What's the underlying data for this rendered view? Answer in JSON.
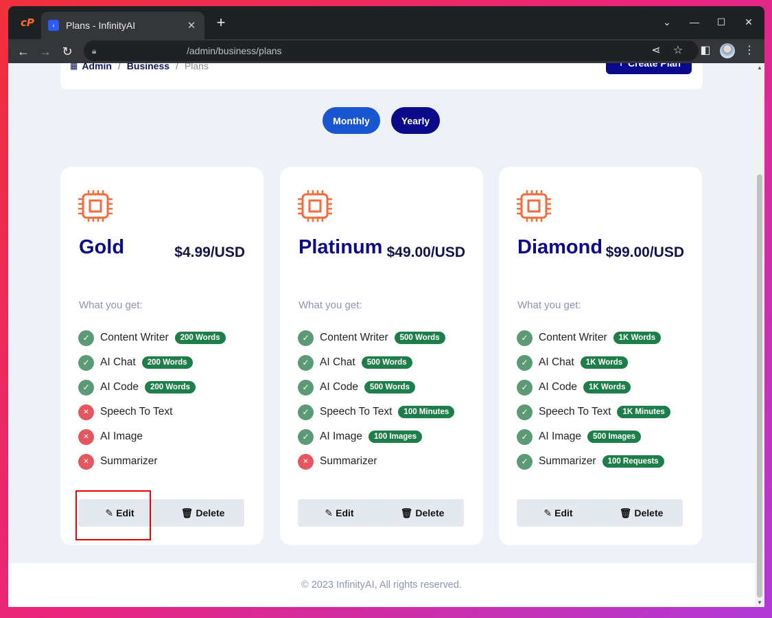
{
  "browser": {
    "tab_title": "Plans - InfinityAI",
    "url": "/admin/business/plans",
    "tab_close": "✕",
    "new_tab": "+"
  },
  "breadcrumb": {
    "items": [
      "Admin",
      "Business"
    ],
    "current": "Plans",
    "separator": "/"
  },
  "header": {
    "create_label": "Create Plan"
  },
  "billing_toggle": {
    "monthly": "Monthly",
    "yearly": "Yearly"
  },
  "plans": [
    {
      "name": "Gold",
      "price": "$4.99/USD",
      "what_you_get": "What you get:",
      "features": [
        {
          "label": "Content Writer",
          "included": true,
          "badge": "200 Words"
        },
        {
          "label": "AI Chat",
          "included": true,
          "badge": "200 Words"
        },
        {
          "label": "AI Code",
          "included": true,
          "badge": "200 Words"
        },
        {
          "label": "Speech To Text",
          "included": false,
          "badge": ""
        },
        {
          "label": "AI Image",
          "included": false,
          "badge": ""
        },
        {
          "label": "Summarizer",
          "included": false,
          "badge": ""
        }
      ],
      "edit_label": "Edit",
      "delete_label": "Delete"
    },
    {
      "name": "Platinum",
      "price": "$49.00/USD",
      "what_you_get": "What you get:",
      "features": [
        {
          "label": "Content Writer",
          "included": true,
          "badge": "500 Words"
        },
        {
          "label": "AI Chat",
          "included": true,
          "badge": "500 Words"
        },
        {
          "label": "AI Code",
          "included": true,
          "badge": "500 Words"
        },
        {
          "label": "Speech To Text",
          "included": true,
          "badge": "100 Minutes"
        },
        {
          "label": "AI Image",
          "included": true,
          "badge": "100 Images"
        },
        {
          "label": "Summarizer",
          "included": false,
          "badge": ""
        }
      ],
      "edit_label": "Edit",
      "delete_label": "Delete"
    },
    {
      "name": "Diamond",
      "price": "$99.00/USD",
      "what_you_get": "What you get:",
      "features": [
        {
          "label": "Content Writer",
          "included": true,
          "badge": "1K Words"
        },
        {
          "label": "AI Chat",
          "included": true,
          "badge": "1K Words"
        },
        {
          "label": "AI Code",
          "included": true,
          "badge": "1K Words"
        },
        {
          "label": "Speech To Text",
          "included": true,
          "badge": "1K Minutes"
        },
        {
          "label": "AI Image",
          "included": true,
          "badge": "500 Images"
        },
        {
          "label": "Summarizer",
          "included": true,
          "badge": "100 Requests"
        }
      ],
      "edit_label": "Edit",
      "delete_label": "Delete"
    }
  ],
  "footer": {
    "text": "© 2023 InfinityAI, All rights reserved."
  },
  "colors": {
    "brand_navy": "#0a0a8a",
    "monthly_blue": "#1a56cf",
    "badge_green": "#1e7e4a",
    "check_green": "#5b9a75",
    "cross_red": "#e4575f",
    "chip_orange": "#f26b3a",
    "highlight_red": "#ee0000"
  }
}
